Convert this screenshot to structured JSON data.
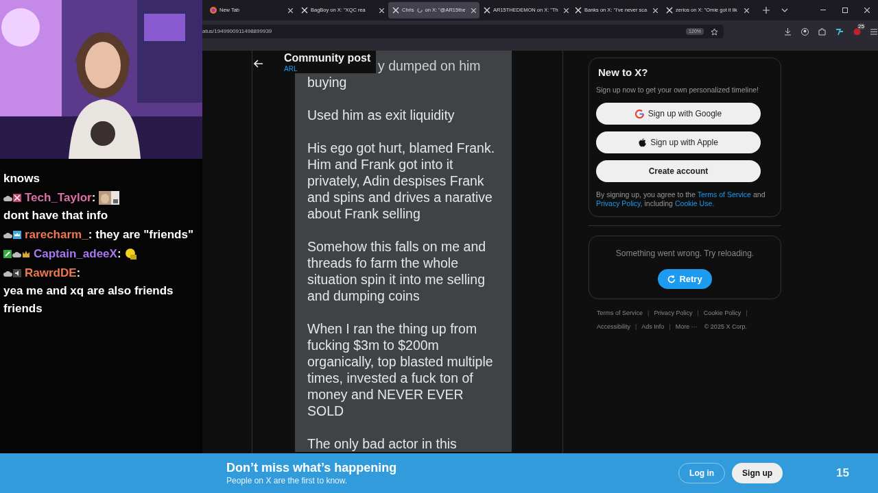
{
  "stream": {
    "chat": [
      {
        "parts": [
          {
            "kind": "text",
            "text": "knows"
          }
        ]
      },
      {
        "user": "Tech_Taylor",
        "separator": ":",
        "color": "#e070a8",
        "badges": [
          {
            "kind": "cloud"
          },
          {
            "kind": "cross"
          }
        ],
        "parts": [
          {
            "kind": "emote"
          },
          {
            "kind": "text",
            "text": "dont have that info"
          }
        ]
      },
      {
        "user": "rarecharm_",
        "separator": ":",
        "color": "#f07850",
        "badges": [
          {
            "kind": "cloud"
          },
          {
            "kind": "crown-box"
          }
        ],
        "parts": [
          {
            "kind": "text",
            "text": "they are \"friends\""
          }
        ]
      },
      {
        "user": "Captain_adeeX",
        "separator": ":",
        "color": "#a878f0",
        "badges": [
          {
            "kind": "sword"
          },
          {
            "kind": "cloud"
          },
          {
            "kind": "crown"
          }
        ],
        "parts": [
          {
            "kind": "emoji"
          }
        ]
      },
      {
        "user": "RawrdDE",
        "separator": ":",
        "color": "#f07850",
        "badges": [
          {
            "kind": "cloud"
          },
          {
            "kind": "speaker"
          }
        ],
        "parts": [
          {
            "kind": "text",
            "text": "yea me and xq are also friends friends"
          }
        ]
      }
    ],
    "timer": "15"
  },
  "browser": {
    "tabs": [
      {
        "kind": "firefox",
        "title": "New Tab",
        "selected": false
      },
      {
        "kind": "x",
        "title": "BagBoy on X: \"XQC rea",
        "selected": false
      },
      {
        "kind": "x",
        "title": "Chris",
        "title_after": "on X: \"@AR15the",
        "loading": true,
        "selected": true
      },
      {
        "kind": "x",
        "title": "AR15THEDEMON on X: \"Th",
        "selected": false
      },
      {
        "kind": "x",
        "title": "Banks on X: \"I've never sca",
        "selected": false
      },
      {
        "kind": "x",
        "title": "zerios on X: \"Omie got it lik",
        "selected": false
      }
    ],
    "url": "atus/1949900911498899939",
    "zoom": "120%",
    "extension_badge": "25"
  },
  "post": {
    "title": "Community post",
    "community": "ARL",
    "image_lines": [
      "y dumped on him"
    ],
    "paragraphs": [
      "buying",
      "Used him as exit liquidity",
      "His ego got hurt, blamed Frank. Him and Frank got into it privately, Adin despises Frank and spins and drives a narative about Frank selling",
      "Somehow this falls on me and threads fo farm the whole situation spin it into me selling and dumping coins",
      "When I ran the thing up from fucking $3m to $200m organically, top blasted multiple times, invested a fuck ton of money and NEVER EVER SOLD",
      "The only bad actor in this"
    ]
  },
  "signup": {
    "title": "New to X?",
    "subtitle": "Sign up now to get your own personalized timeline!",
    "buttons": [
      {
        "kind": "google",
        "label": "Sign up with Google"
      },
      {
        "kind": "apple",
        "label": "Sign up with Apple"
      },
      {
        "kind": "plain",
        "label": "Create account"
      }
    ],
    "legal": [
      {
        "text": "By signing up, you agree to the",
        "link": false
      },
      {
        "text": "Terms of Service",
        "link": true
      },
      {
        "text": "and",
        "link": false
      },
      {
        "text": "Privacy Policy,",
        "link": true
      },
      {
        "text": "including",
        "link": false
      },
      {
        "text": "Cookie Use.",
        "link": true
      }
    ]
  },
  "error": {
    "message": "Something went wrong. Try reloading.",
    "button": "Retry"
  },
  "footer_links": [
    {
      "text": "Terms of Service",
      "separator": "|"
    },
    {
      "text": "Privacy Policy",
      "separator": "|"
    },
    {
      "text": "Cookie Policy",
      "separator": "|"
    },
    {
      "text": "Accessibility",
      "separator": "|"
    },
    {
      "text": "Ads Info",
      "separator": "|"
    },
    {
      "text": "More ···"
    },
    {
      "text": "© 2025 X Corp."
    }
  ],
  "banner": {
    "title": "Don’t miss what’s happening",
    "subtitle": "People on X are the first to know.",
    "login": "Log in",
    "signup": "Sign up"
  }
}
